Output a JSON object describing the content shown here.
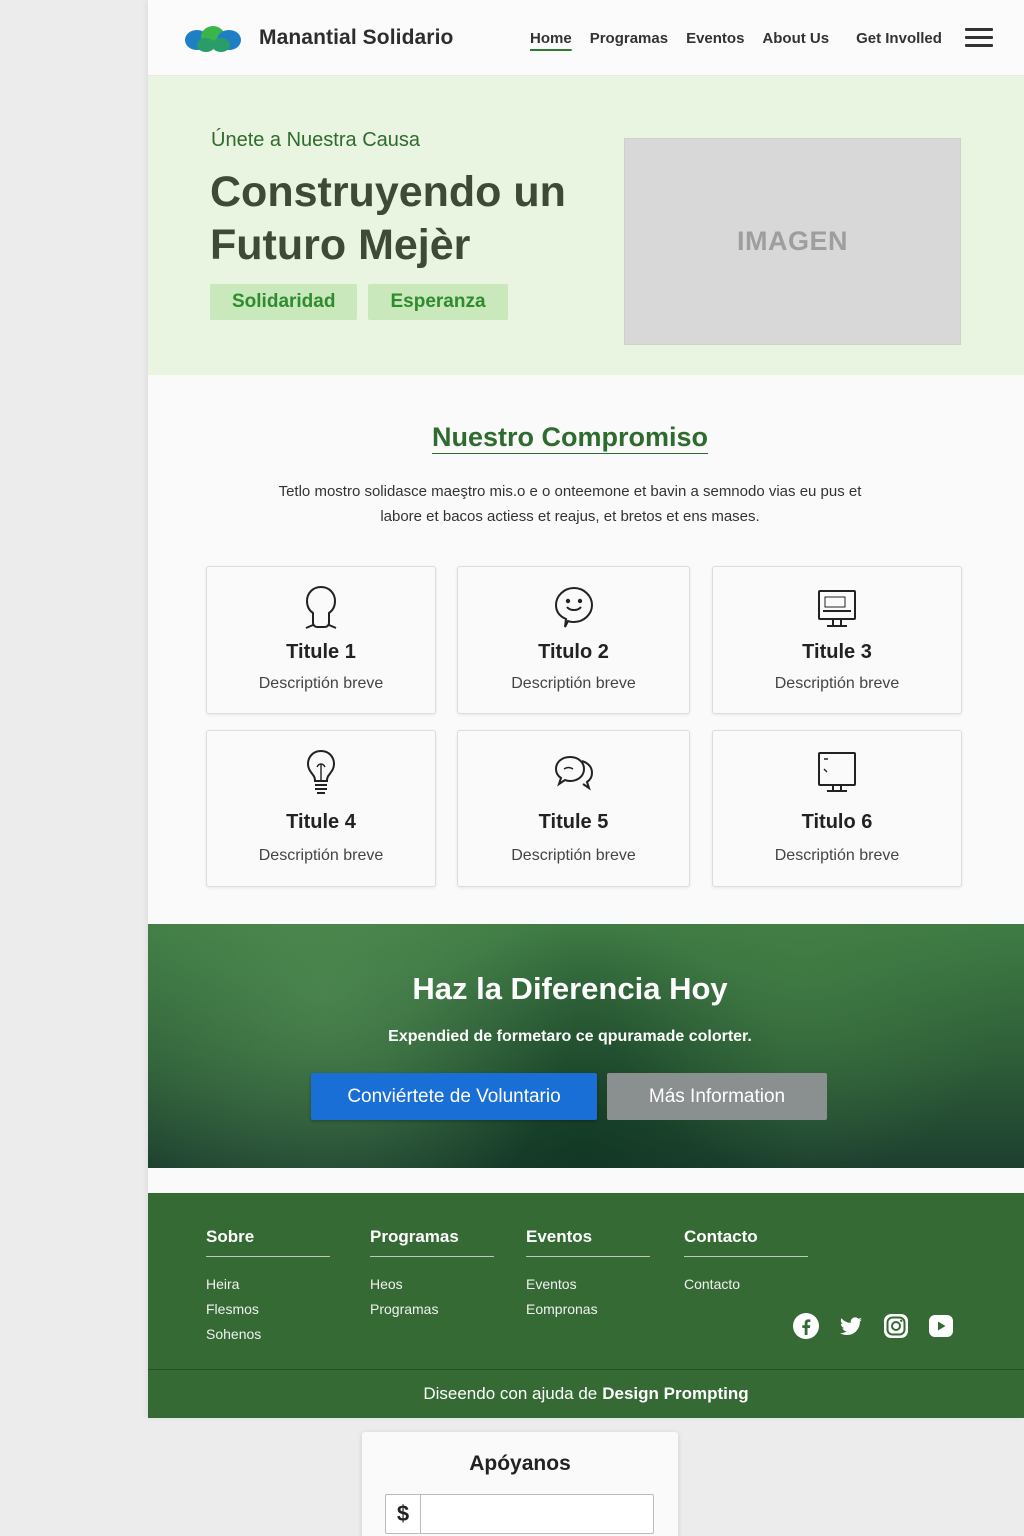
{
  "header": {
    "brand": "Manantial Solidario",
    "nav": [
      "Home",
      "Programas",
      "Eventos",
      "About Us",
      "Get Involled"
    ],
    "active_nav": "Home"
  },
  "hero": {
    "eyebrow": "Únete a Nuestra Causa",
    "title": "Construyendo un Futuro Mejèr",
    "tags": [
      "Solidaridad",
      "Esperanza"
    ],
    "image_placeholder": "IMAGEN"
  },
  "commitment": {
    "title": "Nuestro Compromiso",
    "text": "Tetlo mostro solidasce maeştro mis.o e o onteemone et bavin a semnodo vias eu pus et labore et bacos actiess et reajus, et bretos et ens mases.",
    "cards": [
      {
        "title": "Titule 1",
        "desc": "Descriptión breve",
        "icon": "person-head-icon"
      },
      {
        "title": "Titulo 2",
        "desc": "Descriptión breve",
        "icon": "speech-bubble-icon"
      },
      {
        "title": "Titule 3",
        "desc": "Descriptión breve",
        "icon": "monitor-icon"
      },
      {
        "title": "Titule 4",
        "desc": "Descriptión breve",
        "icon": "lightbulb-icon"
      },
      {
        "title": "Titule 5",
        "desc": "Descriptión breve",
        "icon": "chat-bubbles-icon"
      },
      {
        "title": "Titulo 6",
        "desc": "Descriptión breve",
        "icon": "monitor-icon"
      }
    ]
  },
  "cta": {
    "title": "Haz la Diferencia Hoy",
    "text": "Expendied de formetaro ce qpuramade colorter.",
    "primary_button": "Conviértete de Voluntario",
    "secondary_button": "Más Information"
  },
  "footer": {
    "columns": [
      {
        "title": "Sobre",
        "links": [
          "Heira",
          "Flesmos",
          "Sohenos"
        ]
      },
      {
        "title": "Programas",
        "links": [
          "Heos",
          "Programas"
        ]
      },
      {
        "title": "Eventos",
        "links": [
          "Eventos",
          "Eompronas"
        ]
      },
      {
        "title": "Contacto",
        "links": [
          "Contacto"
        ]
      }
    ],
    "social": [
      "facebook-icon",
      "twitter-icon",
      "instagram-icon",
      "youtube-icon"
    ],
    "credit_prefix": "Diseendo con ajuda de",
    "credit_brand": "Design Prompting"
  },
  "donate": {
    "title": "Apóyanos",
    "currency": "$",
    "amount_value": ""
  },
  "colors": {
    "brand_green": "#2e6b2e",
    "hero_bg": "#e9f5e1",
    "tag_bg": "#c9e8bc",
    "primary_blue": "#1a6fd6",
    "footer_green": "#356a35"
  }
}
